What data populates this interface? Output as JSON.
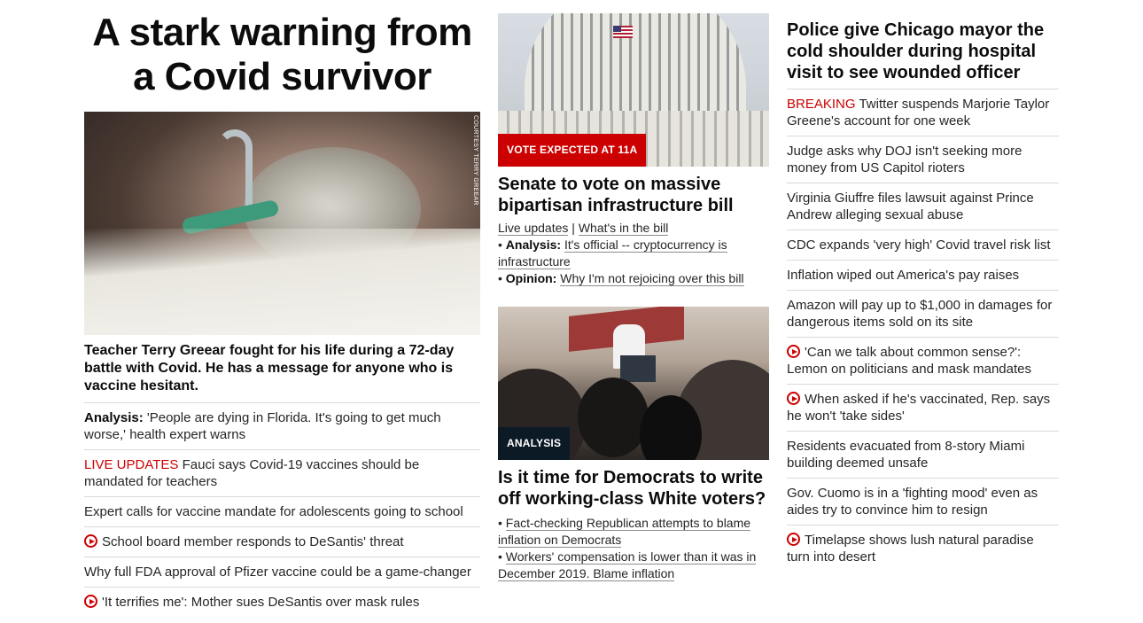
{
  "col1": {
    "hero_headline": "A stark warning from a Covid survivor",
    "image_credit": "COURTESY TERRY GREEAR",
    "hero_desc": "Teacher Terry Greear fought for his life during a 72-day battle with Covid. He has a message for anyone who is vaccine hesitant.",
    "items": [
      {
        "prefix": "Analysis:",
        "text": "'People are dying in Florida. It's going to get much worse,' health expert warns"
      },
      {
        "red_prefix": "LIVE UPDATES",
        "text": "Fauci says Covid-19 vaccines should be mandated for teachers"
      },
      {
        "text": "Expert calls for vaccine mandate for adolescents going to school"
      },
      {
        "text": "School board member responds to DeSantis' threat"
      },
      {
        "text": "Why full FDA approval of Pfizer vaccine could be a game-changer"
      },
      {
        "text": "'It terrifies me': Mother sues DeSantis over mask rules"
      }
    ]
  },
  "col2": {
    "story1": {
      "label": "VOTE EXPECTED AT 11A",
      "headline": "Senate to vote on massive bipartisan infrastructure bill",
      "link_a": "Live updates",
      "link_sep": "|",
      "link_b": "What's in the bill",
      "bullet": "•",
      "analysis_prefix": "Analysis:",
      "analysis_text": "It's official -- cryptocurrency is infrastructure",
      "opinion_prefix": "Opinion:",
      "opinion_text": "Why I'm not rejoicing over this bill"
    },
    "story2": {
      "label": "ANALYSIS",
      "headline": "Is it time for Democrats to write off working-class White voters?",
      "bullet": "•",
      "link1": "Fact-checking Republican attempts to blame inflation on Democrats",
      "link2": "Workers' compensation is lower than it was in December 2019. Blame inflation"
    }
  },
  "col3": {
    "headline": "Police give Chicago mayor the cold shoulder during hospital visit to see wounded officer",
    "items": [
      {
        "red_prefix": "BREAKING",
        "text": "Twitter suspends Marjorie Taylor Greene's account for one week"
      },
      {
        "text": "Judge asks why DOJ isn't seeking more money from US Capitol rioters"
      },
      {
        "text": "Virginia Giuffre files lawsuit against Prince Andrew alleging sexual abuse"
      },
      {
        "text": "CDC expands 'very high' Covid travel risk list"
      },
      {
        "text": "Inflation wiped out America's pay raises"
      },
      {
        "text": "Amazon will pay up to $1,000 in damages for dangerous items sold on its site"
      },
      {
        "text": "'Can we talk about common sense?': Lemon on politicians and mask mandates"
      },
      {
        "text": "When asked if he's vaccinated, Rep. says he won't 'take sides'"
      },
      {
        "text": "Residents evacuated from 8-story Miami building deemed unsafe"
      },
      {
        "text": "Gov. Cuomo is in a 'fighting mood' even as aides try to convince him to resign"
      },
      {
        "text": "Timelapse shows lush natural paradise turn into desert"
      }
    ]
  },
  "icons": {
    "video": "play-circle-icon",
    "accent": "#cc0000",
    "dark_label": "#0c1a26"
  }
}
